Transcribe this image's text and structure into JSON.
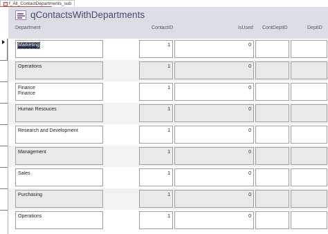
{
  "tab": {
    "label": "f_All_ContactDepartments_sub"
  },
  "header": {
    "title": "qContactsWithDepartments",
    "columns": {
      "department": "Department",
      "contact_id": "ContactID",
      "is_used": "IsUsed",
      "cont_dept_id": "ContDeptID",
      "dept_id": "DeptID"
    }
  },
  "records": [
    {
      "department": "Marketing",
      "contact_id": "1",
      "is_used": "0",
      "cont_dept_id": "",
      "dept_id": ""
    },
    {
      "department": "Operations",
      "contact_id": "1",
      "is_used": "0",
      "cont_dept_id": "",
      "dept_id": ""
    },
    {
      "department": "Finance\nFinance",
      "contact_id": "1",
      "is_used": "0",
      "cont_dept_id": "",
      "dept_id": ""
    },
    {
      "department": "Human Resouces",
      "contact_id": "1",
      "is_used": "0",
      "cont_dept_id": "",
      "dept_id": ""
    },
    {
      "department": "Research and Development",
      "contact_id": "1",
      "is_used": "0",
      "cont_dept_id": "",
      "dept_id": ""
    },
    {
      "department": "Management",
      "contact_id": "1",
      "is_used": "0",
      "cont_dept_id": "",
      "dept_id": ""
    },
    {
      "department": "Sales",
      "contact_id": "1",
      "is_used": "0",
      "cont_dept_id": "",
      "dept_id": ""
    },
    {
      "department": "Purchasing",
      "contact_id": "1",
      "is_used": "0",
      "cont_dept_id": "",
      "dept_id": ""
    },
    {
      "department": "Operations",
      "contact_id": "1",
      "is_used": "0",
      "cont_dept_id": "",
      "dept_id": ""
    }
  ]
}
